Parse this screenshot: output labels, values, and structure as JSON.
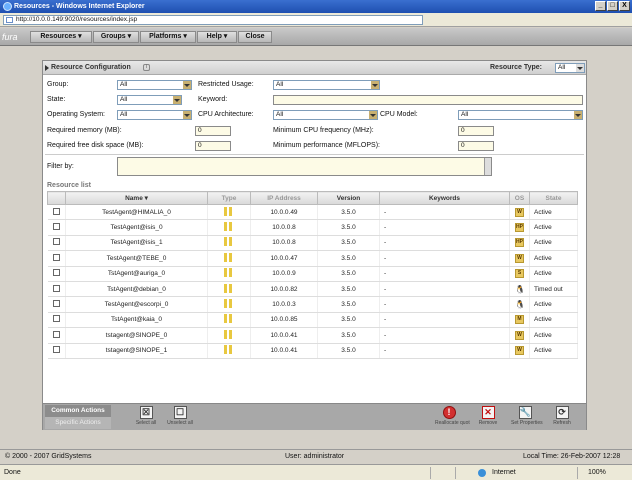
{
  "window": {
    "title": "Resources - Windows Internet Explorer",
    "controls": [
      "_",
      "□",
      "X"
    ]
  },
  "address": {
    "url": "http://10.0.0.149:9020/resources/index.jsp"
  },
  "menu": {
    "logo": "fura",
    "items": [
      "Resources ▾",
      "Groups ▾",
      "Platforms ▾",
      "Help ▾",
      "Close"
    ]
  },
  "config": {
    "title": "Resource Configuration",
    "resource_type_label": "Resource Type:",
    "resource_type_value": "All",
    "group_label": "Group:",
    "group_value": "All",
    "restricted_label": "Restricted Usage:",
    "restricted_value": "All",
    "state_label": "State:",
    "state_value": "All",
    "keyword_label": "Keyword:",
    "keyword_value": "",
    "os_label": "Operating System:",
    "os_value": "All",
    "cpu_arch_label": "CPU Architecture:",
    "cpu_arch_value": "All",
    "cpu_model_label": "CPU Model:",
    "cpu_model_value": "All",
    "req_mem_label": "Required memory (MB):",
    "req_mem_value": "0",
    "min_cpu_label": "Minimum CPU frequency (MHz):",
    "min_cpu_value": "0",
    "req_disk_label": "Required free disk space (MB):",
    "req_disk_value": "0",
    "min_perf_label": "Minimum performance (MFLOPS):",
    "min_perf_value": "0",
    "filter_label": "Filter by:"
  },
  "resource_list": {
    "title": "Resource list",
    "columns": [
      "",
      "Name ▾",
      "Type",
      "IP Address",
      "Version",
      "Keywords",
      "OS",
      "State"
    ],
    "rows": [
      {
        "name": "TestAgent@HIMALIA_0",
        "ip": "10.0.0.49",
        "version": "3.5.0",
        "keywords": "-",
        "os": "W",
        "state": "Active"
      },
      {
        "name": "TestAgent@isis_0",
        "ip": "10.0.0.8",
        "version": "3.5.0",
        "keywords": "-",
        "os": "HP",
        "state": "Active"
      },
      {
        "name": "TestAgent@isis_1",
        "ip": "10.0.0.8",
        "version": "3.5.0",
        "keywords": "-",
        "os": "HP",
        "state": "Active"
      },
      {
        "name": "TestAgent@TEBE_0",
        "ip": "10.0.0.47",
        "version": "3.5.0",
        "keywords": "-",
        "os": "W",
        "state": "Active"
      },
      {
        "name": "TstAgent@auriga_0",
        "ip": "10.0.0.9",
        "version": "3.5.0",
        "keywords": "-",
        "os": "S",
        "state": "Active"
      },
      {
        "name": "TstAgent@debian_0",
        "ip": "10.0.0.82",
        "version": "3.5.0",
        "keywords": "-",
        "os": "🐧",
        "state": "Timed out"
      },
      {
        "name": "TestAgent@escorpi_0",
        "ip": "10.0.0.3",
        "version": "3.5.0",
        "keywords": "-",
        "os": "🐧",
        "state": "Active"
      },
      {
        "name": "TstAgent@kaia_0",
        "ip": "10.0.0.85",
        "version": "3.5.0",
        "keywords": "-",
        "os": "M",
        "state": "Active"
      },
      {
        "name": "tstagent@SINOPE_0",
        "ip": "10.0.0.41",
        "version": "3.5.0",
        "keywords": "-",
        "os": "W",
        "state": "Active"
      },
      {
        "name": "tstagent@SINOPE_1",
        "ip": "10.0.0.41",
        "version": "3.5.0",
        "keywords": "-",
        "os": "W",
        "state": "Active"
      }
    ]
  },
  "actions": {
    "common_tab": "Common Actions",
    "specific_tab": "Specific Actions",
    "select_all": "Select all",
    "unselect_all": "Unselect all",
    "reallocate": "Reallocate quot",
    "remove": "Remove",
    "set_properties": "Set Properties",
    "refresh": "Refresh"
  },
  "footer": {
    "copyright": "© 2000 - 2007 GridSystems",
    "user": "User: administrator",
    "local_time": "Local Time:  26-Feb-2007 12:28"
  },
  "statusbar": {
    "left": "Done",
    "zone": "Internet",
    "zoom": "100%"
  }
}
